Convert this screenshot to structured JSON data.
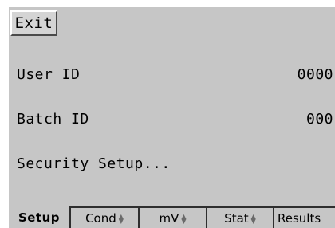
{
  "exit_label": "Exit",
  "rows": {
    "user": {
      "label": "User ID",
      "value": "0000"
    },
    "batch": {
      "label": "Batch ID",
      "value": "000"
    },
    "security": {
      "label": "Security Setup..."
    }
  },
  "tabs": [
    {
      "label": "Setup",
      "active": true,
      "icon": null
    },
    {
      "label": "Cond",
      "active": false,
      "icon": "up-down-arrow-icon"
    },
    {
      "label": "mV",
      "active": false,
      "icon": "up-down-arrow-icon"
    },
    {
      "label": "Stat",
      "active": false,
      "icon": "up-down-arrow-icon"
    },
    {
      "label": "Results",
      "active": false,
      "icon": null
    }
  ],
  "colors": {
    "panel_background": "#c6c6c6",
    "tab_border": "#2e2e2e",
    "arrow_icon": "#6a6a6a"
  }
}
